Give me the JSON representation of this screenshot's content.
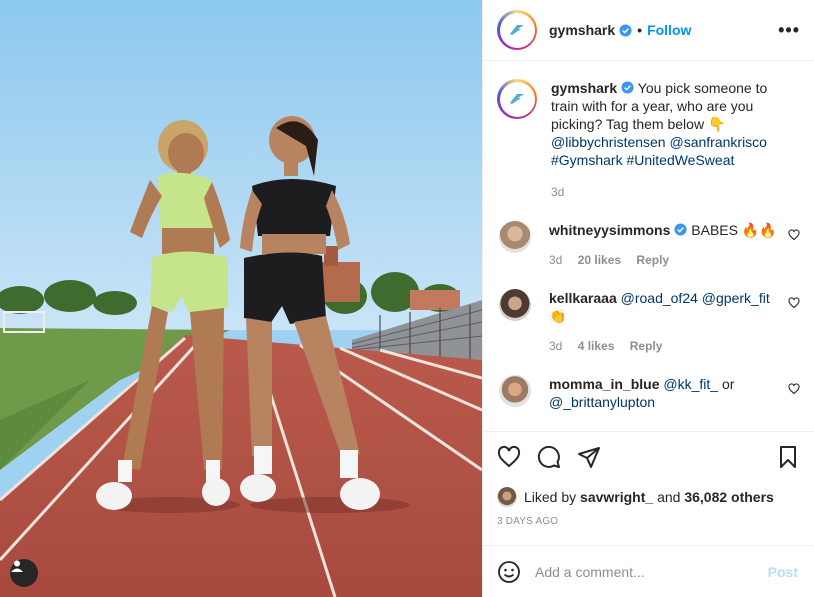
{
  "colors": {
    "accent": "#0095f6",
    "link": "#00376b",
    "muted": "#8e8e8e"
  },
  "header": {
    "username": "gymshark",
    "separator": "•",
    "follow_label": "Follow",
    "more_label": "•••"
  },
  "caption": {
    "username": "gymshark",
    "text": "You pick someone to train with for a year, who are you picking? Tag them below 👇",
    "mentions": [
      "@libbychristensen",
      "@sanfrankrisco"
    ],
    "hashtags": [
      "#Gymshark",
      "#UnitedWeSweat"
    ],
    "time": "3d"
  },
  "comments": [
    {
      "username": "whitneyysimmons",
      "verified": true,
      "text": "BABES 🔥🔥",
      "time": "3d",
      "likes": "20 likes",
      "reply": "Reply"
    },
    {
      "username": "kellkaraaa",
      "verified": false,
      "mentions": [
        "@road_of24",
        "@gperk_fit"
      ],
      "text": "👏",
      "time": "3d",
      "likes": "4 likes",
      "reply": "Reply"
    },
    {
      "username": "momma_in_blue",
      "verified": false,
      "mentions": [
        "@kk_fit_"
      ],
      "conj": "or",
      "mention2": "@_brittanylupton"
    }
  ],
  "likes": {
    "prefix": "Liked by",
    "user": "savwright_",
    "conj": "and",
    "others": "36,082 others"
  },
  "date": "3 DAYS AGO",
  "composer": {
    "placeholder": "Add a comment...",
    "post_label": "Post"
  },
  "icons": {
    "like": "heart-icon",
    "comment": "comment-icon",
    "share": "share-icon",
    "save": "bookmark-icon",
    "emoji": "emoji-icon",
    "tag": "user-tag-icon",
    "verified": "verified-badge-icon",
    "more": "more-options-icon"
  }
}
